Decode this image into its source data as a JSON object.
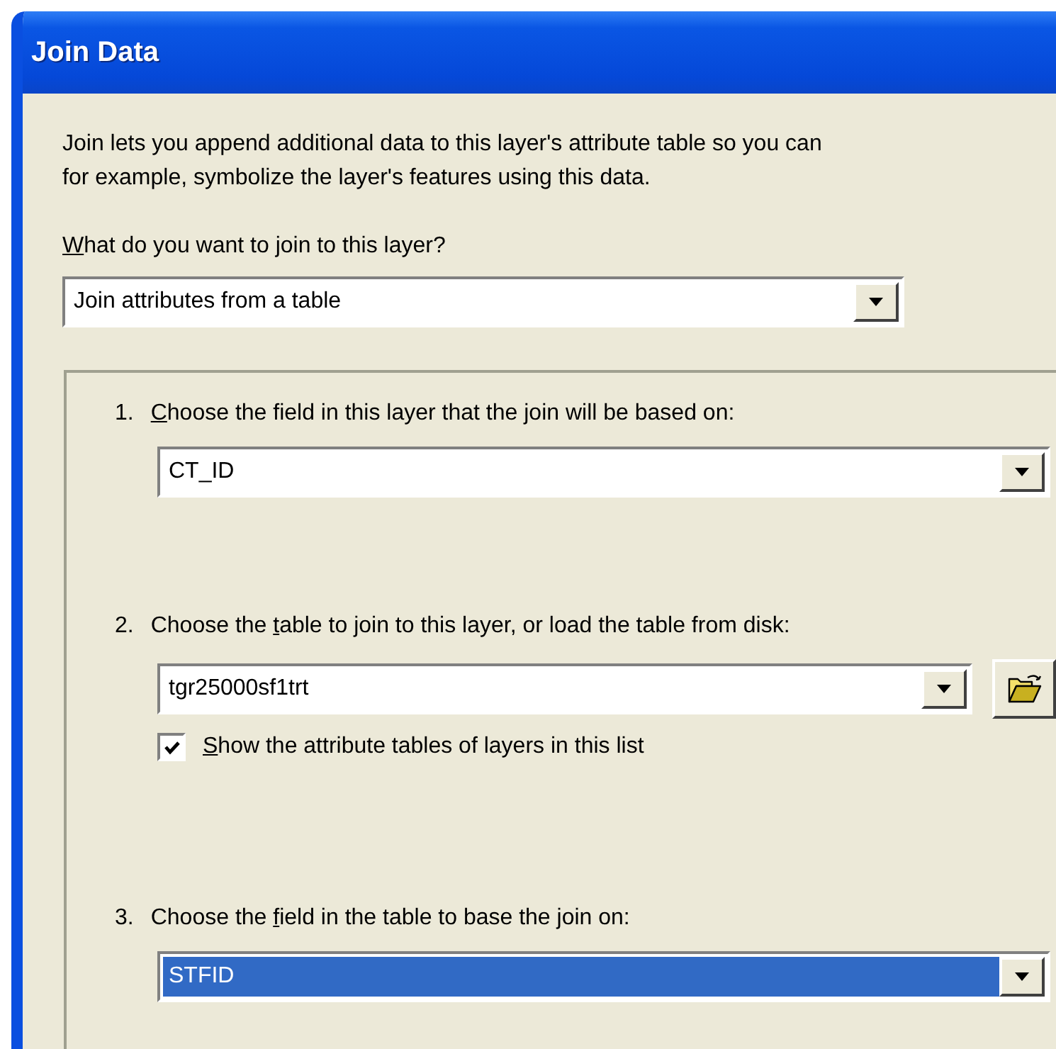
{
  "window": {
    "title": "Join Data"
  },
  "description": "Join lets you append additional data to this layer's attribute table so you can\nfor example, symbolize the layer's features using this data.",
  "join_type": {
    "label": {
      "key": "W",
      "after": "hat do you want to join to this layer?"
    },
    "value": "Join attributes from a table"
  },
  "steps": [
    {
      "kind": "dropdown",
      "number": "1.",
      "label": {
        "key": "C",
        "after": "hoose the field in this layer that the join will be based on:"
      },
      "value": "CT_ID",
      "selected": false
    },
    {
      "kind": "dropdown_browse",
      "number": "2.",
      "label": {
        "before": "Choose the ",
        "key": "t",
        "after": "able to join to this layer, or load the table from disk:"
      },
      "value": "tgr25000sf1trt",
      "selected": false,
      "checkbox": {
        "label": {
          "key": "S",
          "after": "how the attribute tables of layers in this list"
        },
        "checked": true
      }
    },
    {
      "kind": "dropdown",
      "number": "3.",
      "label": {
        "before": "Choose the ",
        "key": "f",
        "after": "ield in the table to base the join on:"
      },
      "value": "STFID",
      "selected": true
    }
  ]
}
